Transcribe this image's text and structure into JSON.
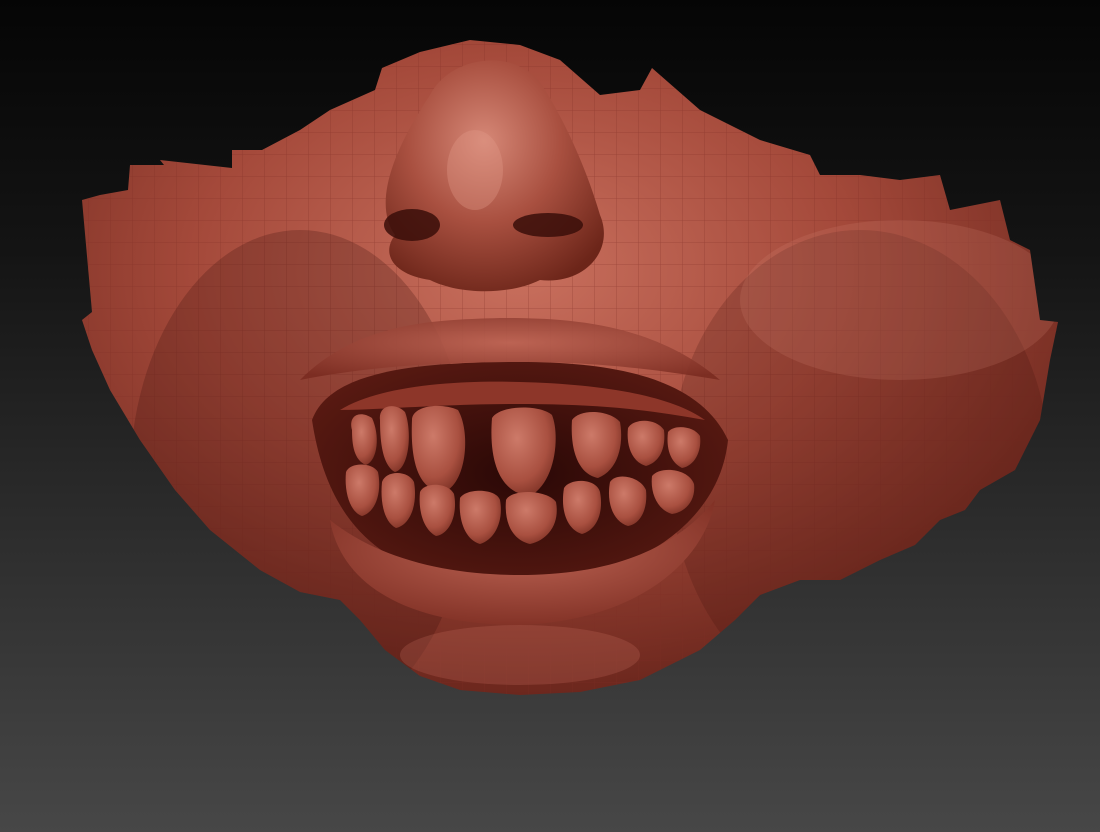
{
  "viewport": {
    "background_top": "#050505",
    "background_bottom": "#474747"
  },
  "model": {
    "subject": "sculpted-mouth-and-nose",
    "surface_color": "#a4493a",
    "highlight_color": "#c9705e",
    "shadow_color": "#4a1510",
    "cavity_color": "#2a0806",
    "teeth_color": "#b0584a",
    "wire_color": "#7d2c22"
  }
}
